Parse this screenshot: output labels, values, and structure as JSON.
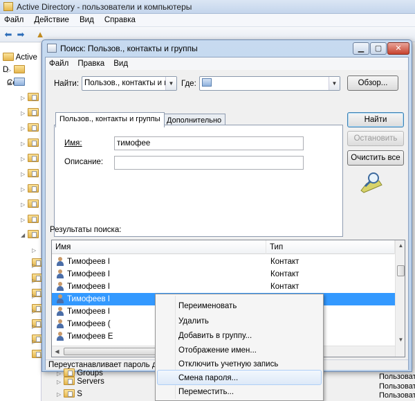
{
  "background_window": {
    "title": "Active Directory - пользователи и компьютеры",
    "menu": [
      "Файл",
      "Действие",
      "Вид",
      "Справка"
    ],
    "tree": [
      {
        "label": "Active D",
        "row": 0
      },
      {
        "label": "Cox",
        "row": 1
      }
    ],
    "tree_bottom": [
      {
        "label": "Groups"
      },
      {
        "label": "Servers"
      },
      {
        "label": "S"
      }
    ],
    "right_column_type": "Пользовате"
  },
  "dialog": {
    "title": "Поиск: Пользов., контакты и группы",
    "menu": [
      "Файл",
      "Правка",
      "Вид"
    ],
    "find_label": "Найти:",
    "find_value": "Пользов., контакты и гр",
    "where_label": "Где:",
    "where_value": "",
    "browse_button": "Обзор...",
    "tabs": [
      "Пользов., контакты и группы",
      "Дополнительно"
    ],
    "name_label": "Имя:",
    "name_value": "тимофее",
    "description_label": "Описание:",
    "description_value": "",
    "find_now_button": "Найти",
    "stop_button": "Остановить",
    "clear_all_button": "Очистить все",
    "results_label": "Результаты поиска:",
    "columns": [
      "Имя",
      "Тип"
    ],
    "rows": [
      {
        "name": "Тимофеев I",
        "type": "Контакт"
      },
      {
        "name": "Тимофеев I",
        "type": "Контакт"
      },
      {
        "name": "Тимофеев I",
        "type": "Контакт"
      },
      {
        "name": "Тимофеев I",
        "type": "Пользователь",
        "selected": true
      },
      {
        "name": "Тимофеев I",
        "type": ""
      },
      {
        "name": "Тимофеев (",
        "type": ""
      },
      {
        "name": "Тимофеев E",
        "type": ""
      }
    ],
    "status": "Переустанавливает пароль дл"
  },
  "context_menu": {
    "items": [
      "Переименовать",
      "Удалить",
      "Добавить в группу...",
      "Отображение имен...",
      "Отключить учетную запись",
      "Смена пароля...",
      "Переместить..."
    ],
    "hovered_index": 5
  },
  "colors": {
    "selection": "#3399ff",
    "title_gradient": "#c7daf0",
    "menu_hover": "#dde9f8"
  }
}
